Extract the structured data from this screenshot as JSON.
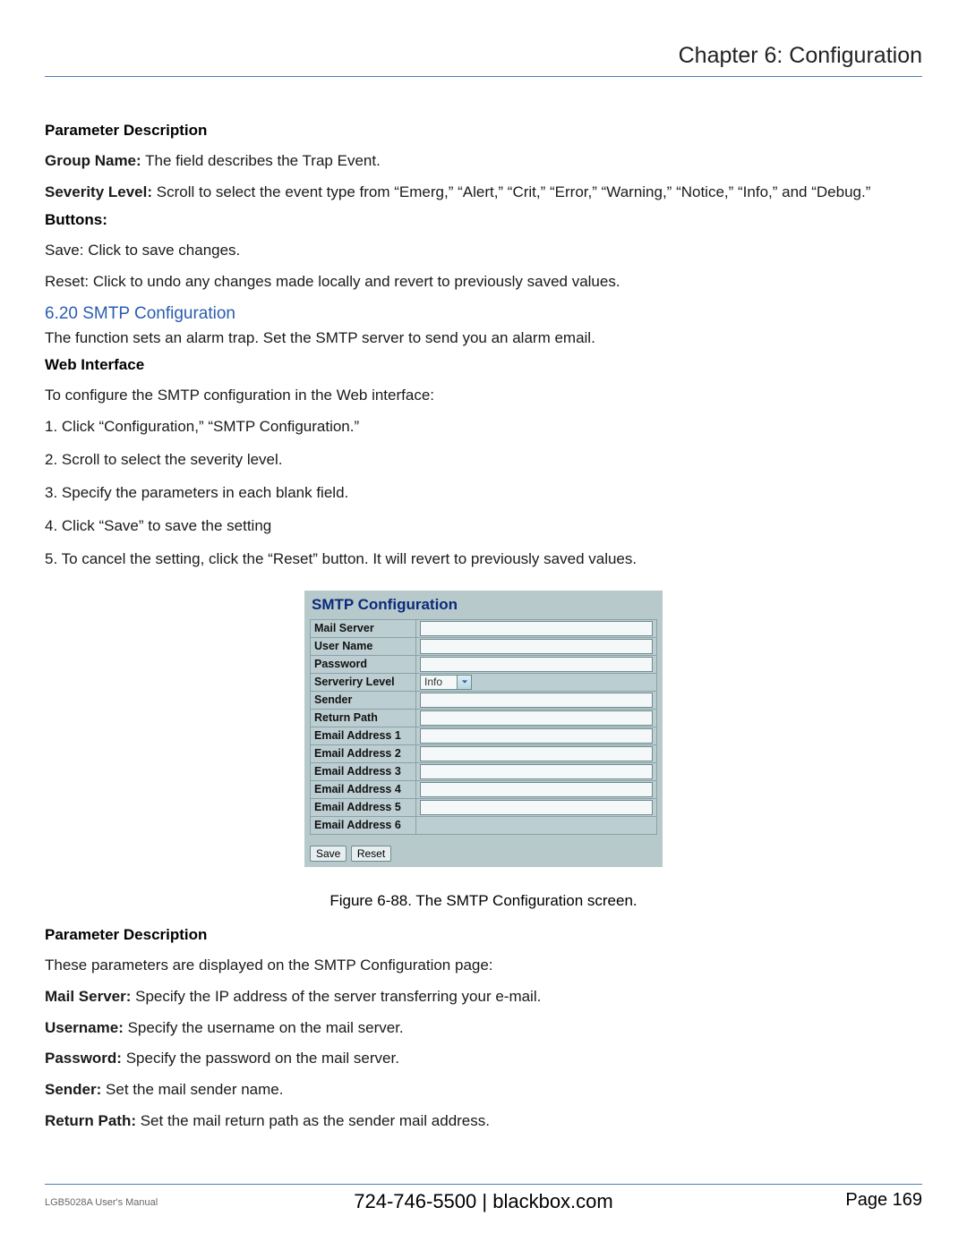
{
  "header": {
    "chapter": "Chapter 6: Configuration"
  },
  "sect1": {
    "title": "Parameter Description",
    "group_name_label": "Group Name:",
    "group_name_text": " The field describes the Trap Event.",
    "severity_label": "Severity Level:",
    "severity_text": " Scroll to select the event type from “Emerg,” “Alert,” “Crit,” “Error,” “Warning,” “Notice,” “Info,” and “Debug.”",
    "buttons_title": "Buttons:",
    "save_line": "Save: Click to save changes.",
    "reset_line": "Reset: Click to undo any changes made locally and revert to previously saved values."
  },
  "smtp": {
    "heading": "6.20 SMTP Configuration",
    "intro": "The function sets an alarm trap. Set the SMTP server to send you an alarm email.",
    "web_title": "Web Interface",
    "web_intro": "To configure the SMTP configuration in the Web interface:",
    "steps": [
      "1. Click “Configuration,” “SMTP Configuration.”",
      "2. Scroll to select the severity level.",
      "3. Specify the parameters in each blank field.",
      "4. Click “Save” to save the setting",
      "5. To cancel the setting, click the “Reset” button. It will revert to previously saved values."
    ]
  },
  "figure": {
    "title": "SMTP Configuration",
    "rows": [
      "Mail Server",
      "User Name",
      "Password",
      "Serveriry Level",
      "Sender",
      "Return Path",
      "Email Address 1",
      "Email Address 2",
      "Email Address 3",
      "Email Address 4",
      "Email Address 5",
      "Email Address 6"
    ],
    "severity_value": "Info",
    "save_btn": "Save",
    "reset_btn": "Reset",
    "caption": "Figure 6-88. The SMTP Configuration screen."
  },
  "sect2": {
    "title": "Parameter Description",
    "intro": "These parameters are displayed on the SMTP Configuration page:",
    "items": [
      {
        "label": "Mail Server:",
        "text": " Specify the IP address of the server transferring your e-mail."
      },
      {
        "label": "Username:",
        "text": " Specify the username on the mail server."
      },
      {
        "label": "Password:",
        "text": " Specify the password on the mail server."
      },
      {
        "label": "Sender:",
        "text": " Set the mail sender name."
      },
      {
        "label": "Return Path:",
        "text": " Set the mail return path as the sender mail address."
      }
    ]
  },
  "footer": {
    "manual": "LGB5028A User's Manual",
    "phone": "724-746-5500",
    "sep": "   |   ",
    "site": "blackbox.com",
    "page": "Page 169"
  }
}
